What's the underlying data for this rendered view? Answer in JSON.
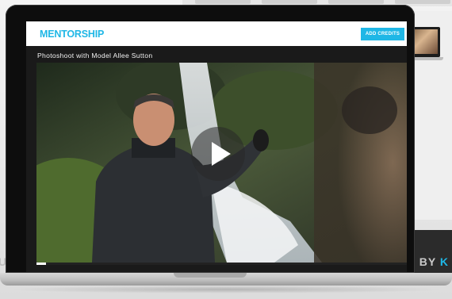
{
  "app": {
    "logo_text": "MENTORSHIP",
    "add_credits_label": "ADD CREDITS",
    "accent_color": "#1fb7e6"
  },
  "video": {
    "title": "Photoshoot with Model Allee Sutton",
    "play_icon": "play-icon",
    "progress_fraction": 0.025
  },
  "background": {
    "right_text_start": "D BY",
    "right_text_accent": "K",
    "left_text": "U"
  }
}
